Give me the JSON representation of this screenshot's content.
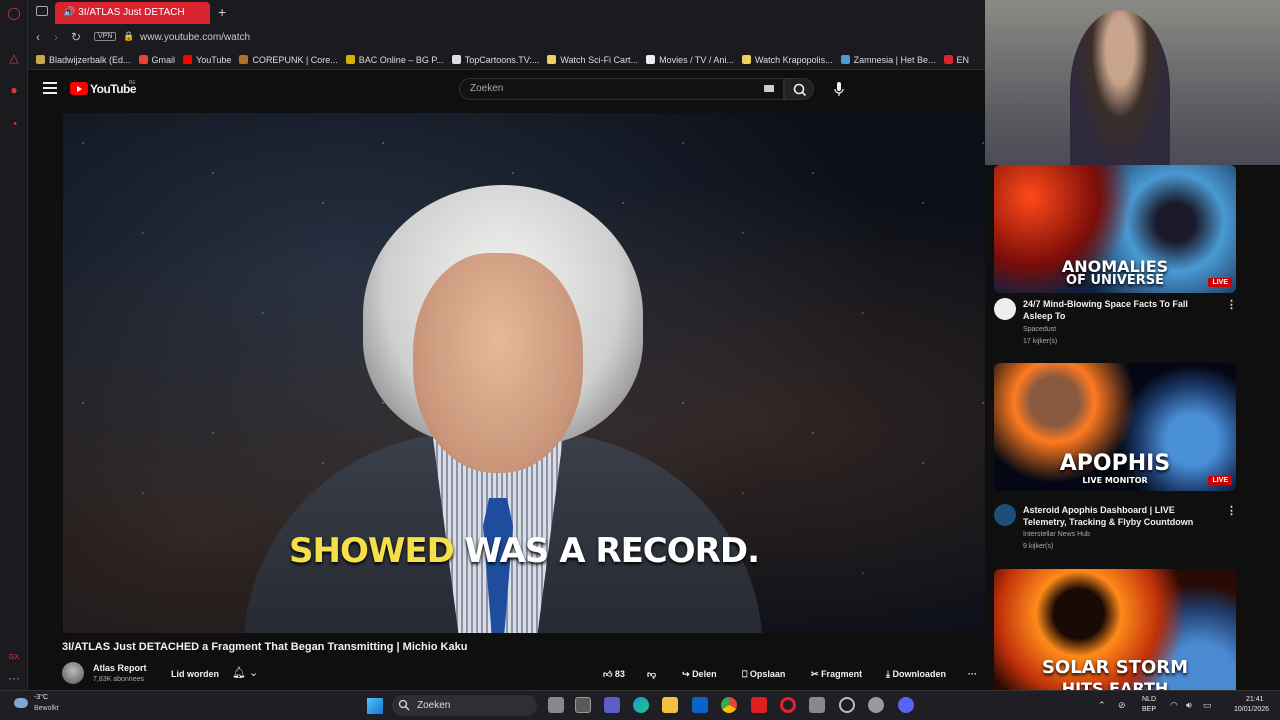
{
  "browser": {
    "tab_title": "3I/ATLAS Just DETACH",
    "url": "www.youtube.com/watch",
    "vpn_label": "VPN",
    "bookmarks": [
      {
        "label": "Bladwijzerbalk (Ed...",
        "color": "#c8a64a"
      },
      {
        "label": "Gmail",
        "color": "#ea4335"
      },
      {
        "label": "YouTube",
        "color": "#ff0000"
      },
      {
        "label": "COREPUNK | Core...",
        "color": "#b07030"
      },
      {
        "label": "BAC Online – BG P...",
        "color": "#d4b000"
      },
      {
        "label": "TopCartoons.TV:...",
        "color": "#dddddd"
      },
      {
        "label": "Watch Sci-Fi Cart...",
        "color": "#f0d060"
      },
      {
        "label": "Movies / TV / Ani...",
        "color": "#eeeeee"
      },
      {
        "label": "Watch Krapopolis...",
        "color": "#f0d060"
      },
      {
        "label": "Zamnesia | Het Be...",
        "color": "#4a9ad4"
      },
      {
        "label": "EN",
        "color": "#d9232e"
      }
    ]
  },
  "youtube": {
    "logo_text": "YouTube",
    "country": "BE",
    "search_placeholder": "Zoeken"
  },
  "video": {
    "subtitle_highlight": "SHOWED",
    "subtitle_rest": " WAS A RECORD.",
    "title": "3I/ATLAS Just DETACHED a Fragment That Began Transmitting | Michio Kaku",
    "channel": "Atlas Report",
    "subscribers": "7,83K abonnees",
    "join_label": "Lid worden",
    "likes": "83",
    "share_label": "Delen",
    "save_label": "Opslaan",
    "clip_label": "Fragment",
    "download_label": "Downloaden"
  },
  "recommendations": [
    {
      "thumb_text_1": "ANOMALIES",
      "thumb_text_2": "OF UNIVERSE",
      "live": "LIVE",
      "title": "24/7 Mind-Blowing Space Facts To Fall Asleep To",
      "channel": "Spacedust",
      "views": "17 kijker(s)"
    },
    {
      "thumb_text_1": "APOPHIS",
      "thumb_text_2": "LIVE MONITOR",
      "live": "LIVE",
      "title": "Asteroid Apophis Dashboard | LIVE Telemetry, Tracking & Flyby Countdown",
      "channel": "Interstellar News Hub",
      "views": "9 kijker(s)"
    },
    {
      "thumb_text_1": "SOLAR STORM",
      "thumb_text_2": "HITS EARTH"
    }
  ],
  "taskbar": {
    "temperature": "-3°C",
    "weather": "Bewolkt",
    "search_label": "Zoeken",
    "lang_1": "NLD",
    "lang_2": "BEP",
    "time": "21:41",
    "date": "10/01/2026"
  },
  "colors": {
    "accent": "#ff0000",
    "opera_red": "#d9232e",
    "subtitle_highlight": "#f5e04a"
  }
}
